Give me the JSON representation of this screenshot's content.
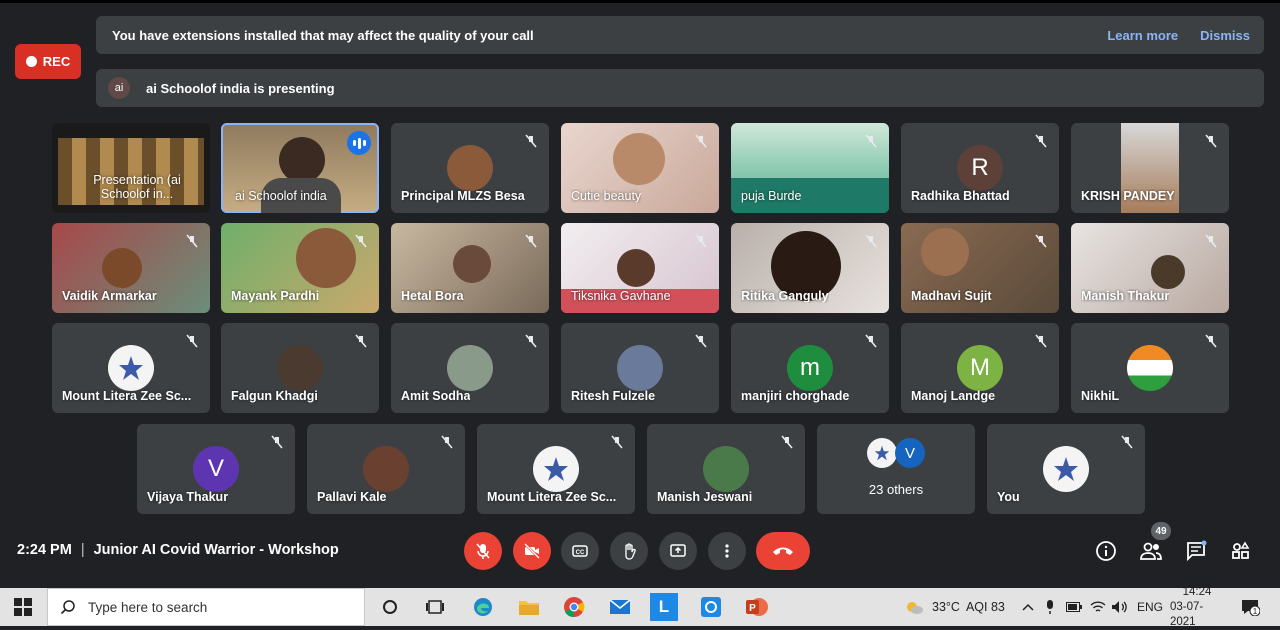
{
  "banner": {
    "extensions_text": "You have extensions installed that may affect the quality of your call",
    "learn_more": "Learn more",
    "dismiss": "Dismiss",
    "presenter_badge": "ai",
    "presenting_text": "ai Schoolof india is presenting"
  },
  "rec_label": "REC",
  "tiles": {
    "t0": "Presentation (ai Schoolof in...",
    "t1": "ai Schoolof india",
    "t2": "Principal MLZS Besa",
    "t3": "Cutie beauty",
    "t4": "puja Burde",
    "t5": "Radhika Bhattad",
    "t5_letter": "R",
    "t6": "KRISH PANDEY",
    "t7": "Vaidik Armarkar",
    "t8": "Mayank Pardhi",
    "t9": "Hetal Bora",
    "t10": "Tiksnika Gavhane",
    "t11": "Ritika Ganguly",
    "t12": "Madhavi Sujit",
    "t13": "Manish Thakur",
    "t14": "Mount Litera Zee Sc...",
    "t15": "Falgun Khadgi",
    "t16": "Amit Sodha",
    "t17": "Ritesh Fulzele",
    "t18": "manjiri chorghade",
    "t18_letter": "m",
    "t19": "Manoj Landge",
    "t19_letter": "M",
    "t20": "NikhiL",
    "t21": "Vijaya Thakur",
    "t21_letter": "V",
    "t22": "Pallavi Kale",
    "t23": "Mount Litera Zee Sc...",
    "t24": "Manish Jeswani",
    "t25": "23 others",
    "t25_letter": "V",
    "t26": "You"
  },
  "meeting": {
    "time": "2:24 PM",
    "title": "Junior AI Covid Warrior - Workshop",
    "participant_count": "49"
  },
  "taskbar": {
    "search_placeholder": "Type here to search",
    "weather": "33°C",
    "aqi": "AQI 83",
    "lang": "ENG",
    "clock_time": "14:24",
    "clock_date": "03-07-2021",
    "notif_count": "1"
  },
  "colors": {
    "bg": "#202124",
    "tile": "#3c4043",
    "accent": "#8ab4f8",
    "red": "#ea4335"
  }
}
